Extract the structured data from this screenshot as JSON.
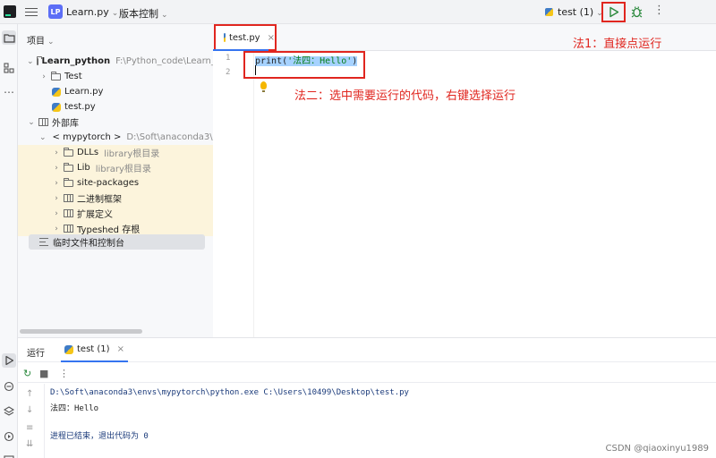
{
  "titlebar": {
    "project_badge": "LP",
    "project_name": "Learn.py",
    "vcs_label": "版本控制",
    "run_config": "test (1)"
  },
  "project_panel": {
    "header": "项目",
    "tree": [
      {
        "label": "Learn_python",
        "meta": "F:\\Python_code\\Learn_py"
      },
      {
        "label": "Test",
        "meta": ""
      },
      {
        "label": "Learn.py",
        "meta": ""
      },
      {
        "label": "test.py",
        "meta": ""
      },
      {
        "label": "外部库",
        "meta": ""
      },
      {
        "label": "< mypytorch >",
        "meta": "D:\\Soft\\anaconda3\\en"
      },
      {
        "label": "DLLs",
        "meta": "library根目录"
      },
      {
        "label": "Lib",
        "meta": "library根目录"
      },
      {
        "label": "site-packages",
        "meta": ""
      },
      {
        "label": "二进制框架",
        "meta": ""
      },
      {
        "label": "扩展定义",
        "meta": ""
      },
      {
        "label": "Typeshed 存根",
        "meta": ""
      },
      {
        "label": "临时文件和控制台",
        "meta": ""
      }
    ]
  },
  "editor": {
    "tab_label": "test.py",
    "line_numbers": [
      "1",
      "2"
    ],
    "code": {
      "func": "print(",
      "string": "'法四：Hello'",
      "close": ")"
    }
  },
  "annotations": {
    "method1": "法1：直接点运行",
    "method2": "法二：选中需要运行的代码，右键选择运行"
  },
  "run_panel": {
    "label": "运行",
    "tab_label": "test (1)",
    "output": [
      "D:\\Soft\\anaconda3\\envs\\mypytorch\\python.exe C:\\Users\\10499\\Desktop\\test.py",
      "法四：Hello",
      "",
      "进程已结束，退出代码为 0"
    ]
  },
  "watermark": "CSDN @qiaoxinyu1989",
  "colors": {
    "annotation_red": "#e0261f",
    "accent_blue": "#3574f0",
    "highlight_yellow": "#fcf4dc"
  }
}
